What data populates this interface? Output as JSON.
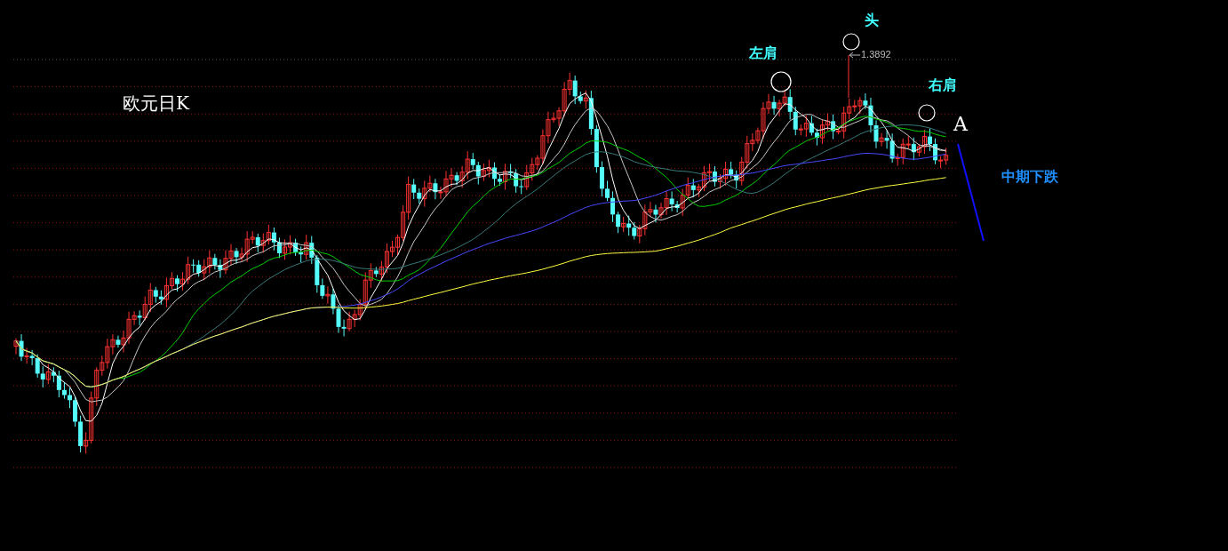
{
  "chart": {
    "title": "欧元日K",
    "annotations": [
      {
        "kind": "left_shoulder",
        "text": "左肩"
      },
      {
        "kind": "head",
        "text": "头"
      },
      {
        "kind": "right_shoulder",
        "text": "右肩"
      }
    ],
    "price_label": "1.3892",
    "point_label": "A",
    "trend_label": "中期下跌"
  }
}
